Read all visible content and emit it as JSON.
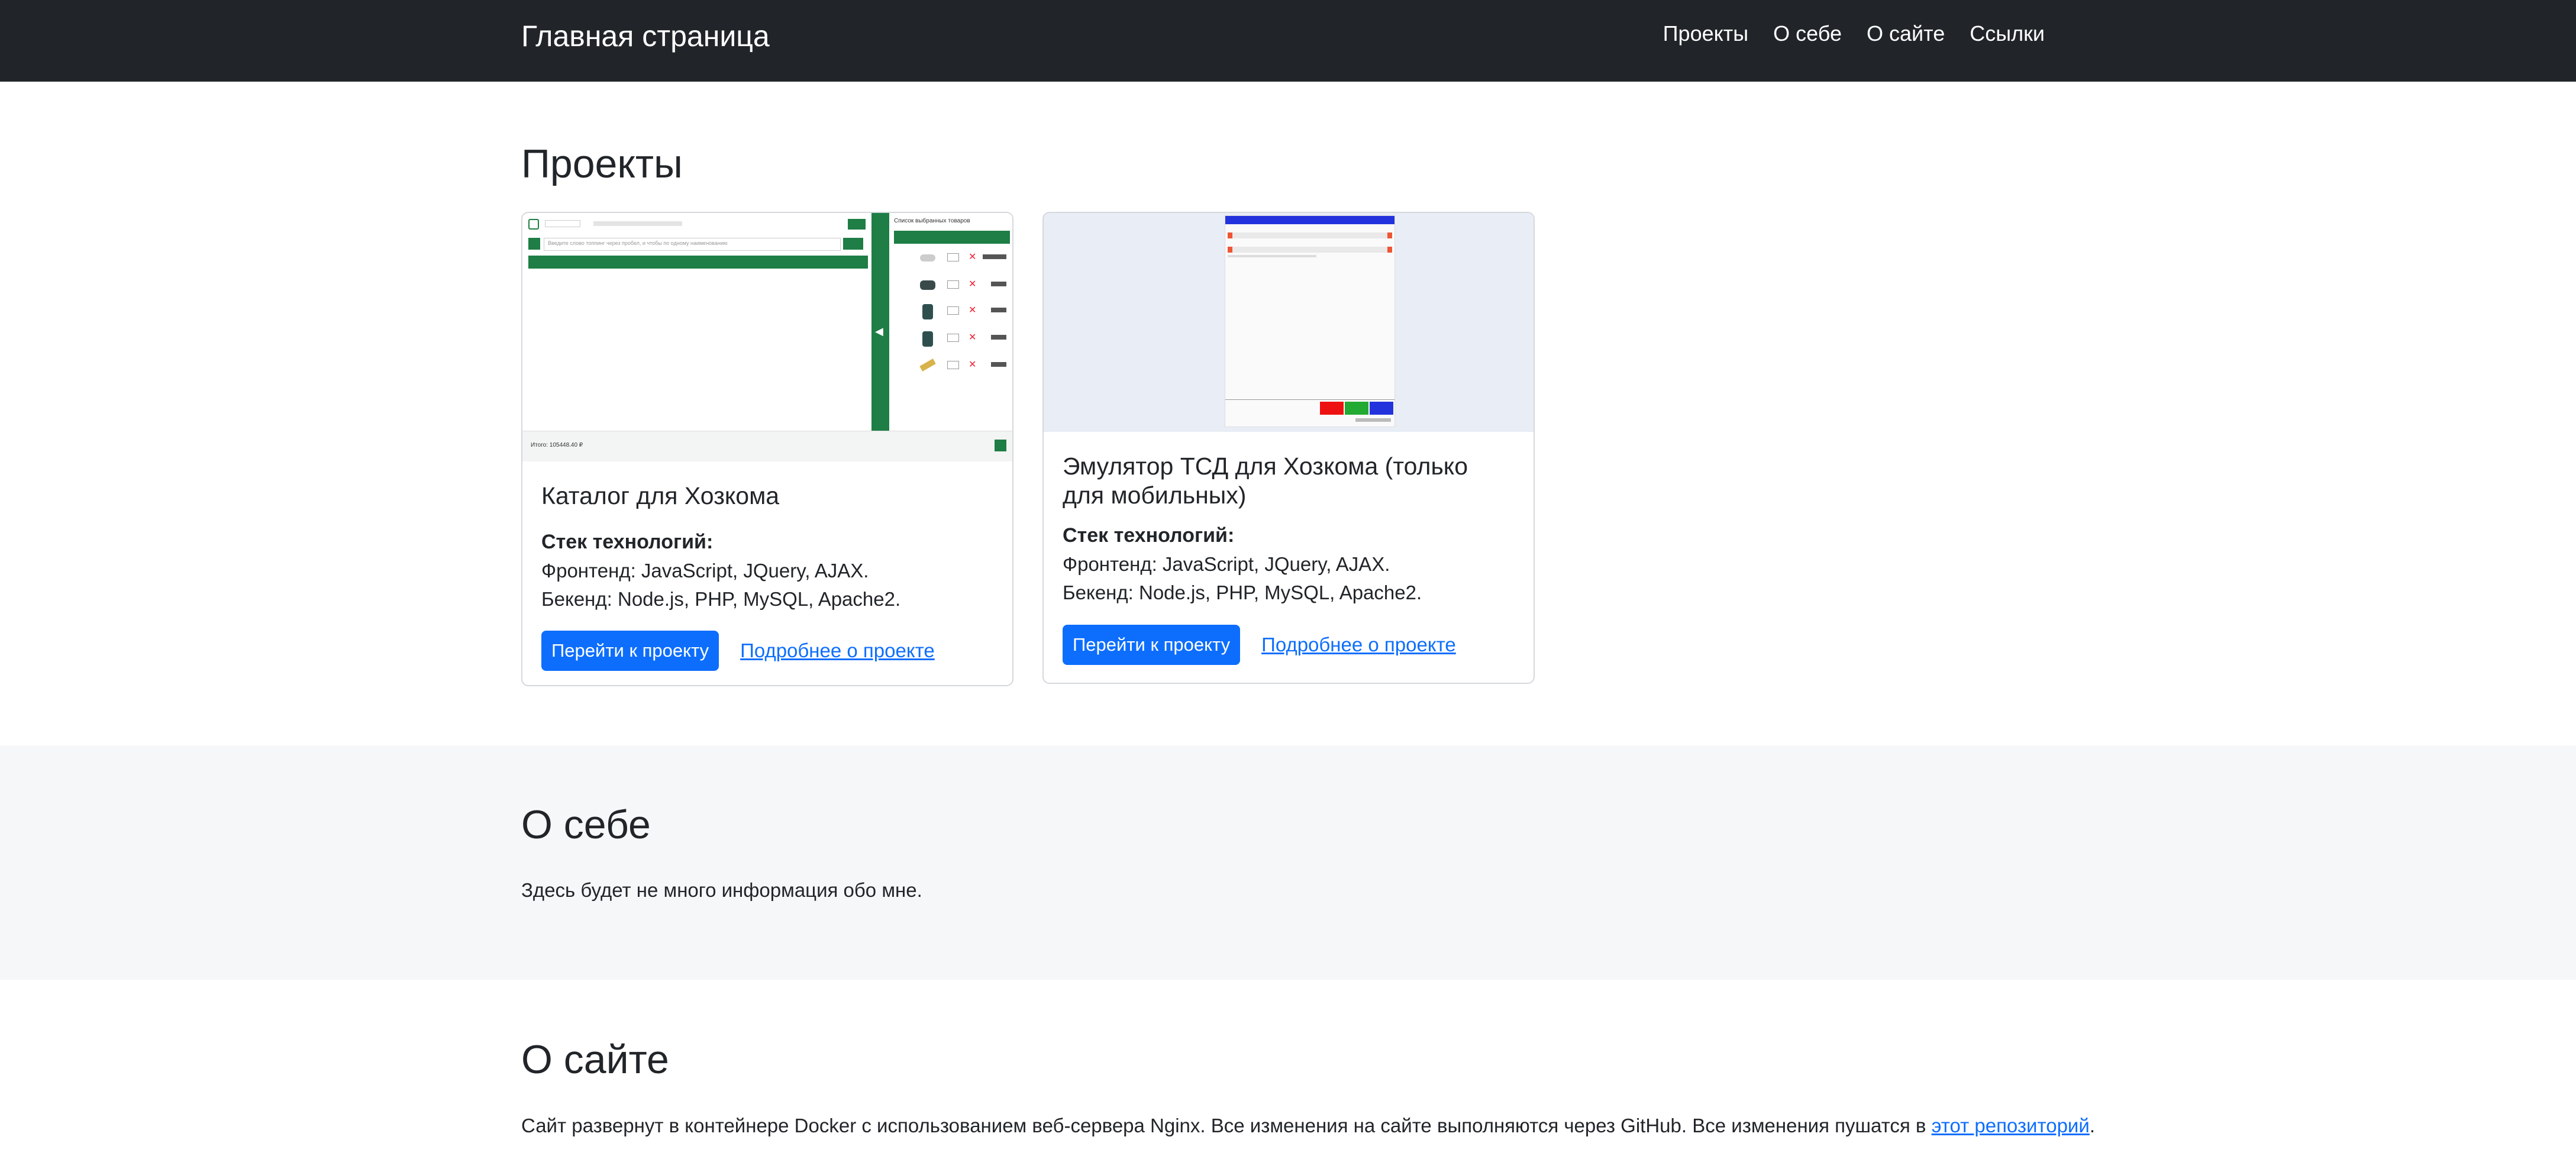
{
  "navbar": {
    "brand": "Главная страница",
    "links": [
      "Проекты",
      "О себе",
      "О сайте",
      "Ссылки"
    ]
  },
  "projects": {
    "title": "Проекты",
    "cards": [
      {
        "title": "Каталог для Хозкома",
        "stack_label": "Стек технологий:",
        "frontend": "Фронтенд: JavaScript, JQuery, AJAX.",
        "backend": "Бекенд: Node.js, PHP, MySQL, Apache2.",
        "button": "Перейти к проекту",
        "link": "Подробнее о проекте",
        "preview": {
          "search_placeholder": "Введите слово топпинг через пробел, и чтобы по одному наименованию",
          "sidebar_title": "Список выбранных товаров",
          "total": "Итого: 105448.40 ₽"
        }
      },
      {
        "title": "Эмулятор ТСД для Хозкома (только для мобильных)",
        "stack_label": "Стек технологий:",
        "frontend": "Фронтенд: JavaScript, JQuery, AJAX.",
        "backend": "Бекенд: Node.js, PHP, MySQL, Apache2.",
        "button": "Перейти к проекту",
        "link": "Подробнее о проекте"
      }
    ]
  },
  "about_me": {
    "title": "О себе",
    "text": "Здесь будет не много информация обо мне."
  },
  "about_site": {
    "title": "О сайте",
    "text": "Сайт развернут в контейнере Docker с использованием веб-сервера Nginx. Все изменения на сайте выполняются через GitHub. Все изменения пушатся в ",
    "link": "этот репозиторий",
    "after": "."
  },
  "colors": {
    "navbar": "#212529",
    "primary": "#0d6efd",
    "band": "#f6f7f8",
    "catalog_green": "#1e7e45"
  }
}
